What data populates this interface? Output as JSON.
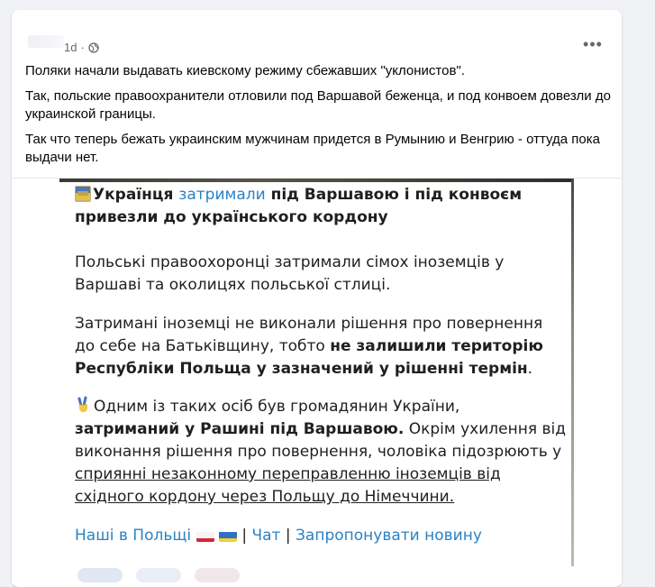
{
  "post": {
    "timestamp": "1d",
    "separator": "·",
    "more_label": "•••",
    "paragraphs": [
      "Поляки начали выдавать киевскому режиму сбежавших \"уклонистов\".",
      "Так, польские правоохранители отловили под Варшавой беженца, и под конвоем довезли до украинской границы.",
      "Так что теперь бежать украинским мужчинам  придется в Румынию и Венгрию - оттуда пока выдачи нет."
    ]
  },
  "telegram": {
    "headline_part1": "Українця ",
    "headline_part2": "затримали",
    "headline_part3": " під Варшавою і під конвоєм привезли до українського кордону",
    "p1": "Польські правоохоронці затримали сімох іноземців у Варшаві та околицях польської стлиці.",
    "p2_normal": "Затримані іноземці не виконали рішення про повернення до себе на Батьківщину, тобто ",
    "p2_bold": "не залишили територію Республіки Польща у зазначений у рішенні термін",
    "p2_end": ".",
    "p3_a": "Одним із таких осіб був громадянин України, ",
    "p3_b": "затриманий у Рашині під Варшавою.",
    "p3_c": " Окрім ухилення від виконання рішення про повернення, чоловіка підозрюють у ",
    "p3_d": "сприянні незаконному переправленню іноземців від східного кордону через Польщу до Німеччини.",
    "footer_link1": "Наші в Польщі",
    "footer_sep": "|",
    "footer_link2": "Чат",
    "footer_link3": "Запропонувати новину"
  },
  "icons": {
    "globe": "globe-icon",
    "more": "more-options-icon",
    "flag": "flag-icon",
    "victory": "victory-hand-icon"
  },
  "colors": {
    "link_blue": "#2a82c4",
    "meta_gray": "#65676b",
    "page_bg": "#f0f2f5"
  }
}
